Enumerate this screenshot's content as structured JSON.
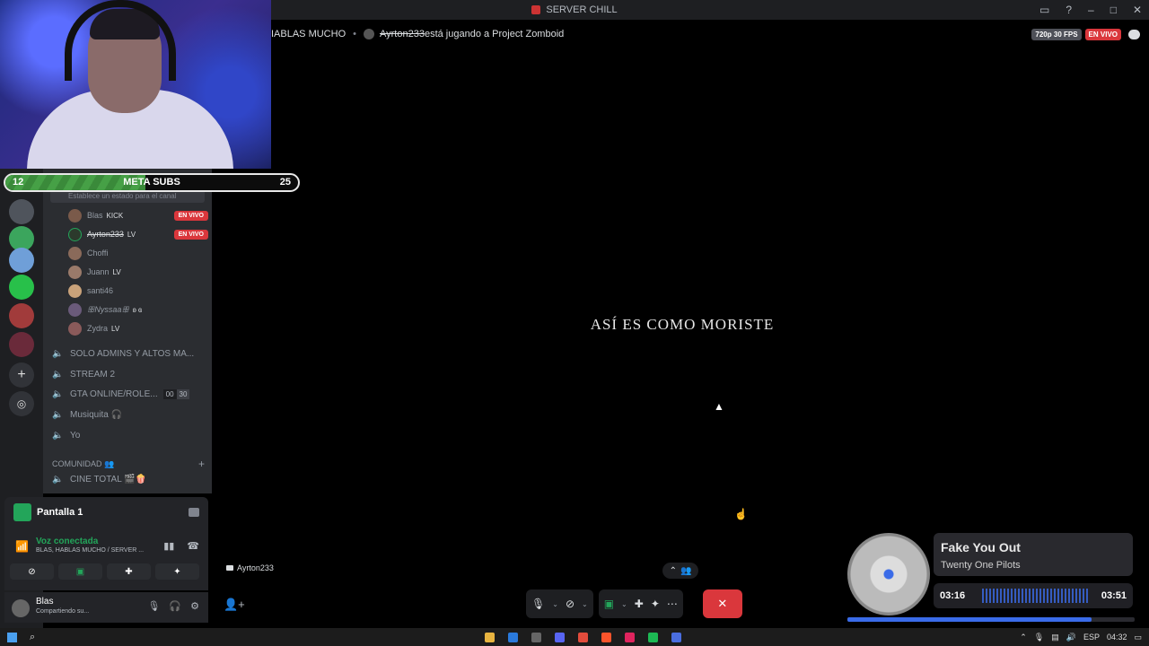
{
  "window": {
    "title": "SERVER CHILL"
  },
  "meta_subs": {
    "label": "META SUBS",
    "current": "12",
    "goal": "25",
    "progress_fraction": 0.48
  },
  "stream_header": {
    "channel_fragment": "IABLAS MUCHO",
    "activity_user": "Ayrton233",
    "activity_text": " está jugando a Project Zomboid",
    "quality": "720p 30 FPS",
    "live_badge": "EN VIVO"
  },
  "sidebar": {
    "status_placeholder": "Establece un estado para el canal",
    "members": [
      {
        "name": "Blas",
        "tag": "KICK",
        "live": "EN VIVO",
        "color": "#7a5a4a"
      },
      {
        "name": "Ayrton233",
        "tag": "LV",
        "live": "EN VIVO",
        "color": "#2c3a2c"
      },
      {
        "name": "Choffi",
        "tag": "",
        "live": "",
        "color": "#8a6a5a"
      },
      {
        "name": "Juann",
        "tag": "LV",
        "live": "",
        "color": "#9a7a6a"
      },
      {
        "name": "santi46",
        "tag": "",
        "live": "",
        "color": "#c9a27a"
      },
      {
        "name": "ꕥNyssaaꕥ",
        "tag": "ʚ ɞ",
        "live": "",
        "color": "#6a5a7a"
      },
      {
        "name": "Zydra",
        "tag": "LV",
        "live": "",
        "color": "#8a5a5a"
      }
    ],
    "voice_channels": [
      {
        "name": "SOLO ADMINS Y ALTOS MA...",
        "count_a": "",
        "count_b": ""
      },
      {
        "name": "STREAM 2",
        "count_a": "",
        "count_b": ""
      },
      {
        "name": "GTA ONLINE/ROLE...",
        "count_a": "00",
        "count_b": "30"
      },
      {
        "name": "Musiquita 🎧",
        "count_a": "",
        "count_b": ""
      },
      {
        "name": "Yo",
        "count_a": "",
        "count_b": ""
      }
    ],
    "category": "COMUNIDAD 👥",
    "cine_channel": "CINE TOTAL 🎬🍿"
  },
  "main": {
    "caption": "ASÍ ES COMO MORISTE",
    "streamer_label": "Ayrton233"
  },
  "screen_panel": {
    "title": "Pantalla 1"
  },
  "voice_panel": {
    "status": "Voz conectada",
    "server": "BLAS, HABLAS MUCHO / SERVER ..."
  },
  "user_panel": {
    "name": "Blas",
    "status": "Compartiendo su..."
  },
  "music": {
    "song": "Fake You Out",
    "artist": "Twenty One Pilots",
    "elapsed": "03:16",
    "total": "03:51",
    "progress_fraction": 0.85
  },
  "taskbar": {
    "lang": "ESP",
    "time": "04:32"
  },
  "colors": {
    "accent_green": "#23a55a",
    "live_red": "#da373c",
    "music_blue": "#3a6be8"
  }
}
